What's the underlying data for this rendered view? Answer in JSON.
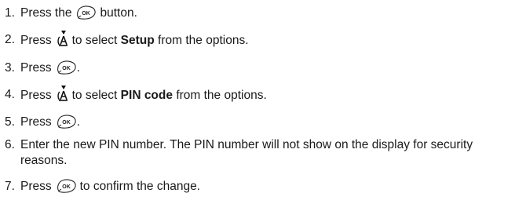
{
  "steps": [
    {
      "num": "1.",
      "before": "Press the",
      "after": "button."
    },
    {
      "num": "2.",
      "before": "Press",
      "mid": "to select",
      "bold": "Setup",
      "after": "from the options."
    },
    {
      "num": "3.",
      "before": "Press",
      "after": "."
    },
    {
      "num": "4.",
      "before": "Press",
      "mid": "to select",
      "bold": "PIN code",
      "after": "from the options."
    },
    {
      "num": "5.",
      "before": "Press",
      "after": "."
    },
    {
      "num": "6.",
      "text": "Enter the new PIN number. The PIN number will not show on the display for security reasons."
    },
    {
      "num": "7.",
      "before": "Press",
      "after": "to confirm the change."
    }
  ],
  "icons": {
    "ok_button": {
      "name": "ok-button-icon",
      "label": "OK"
    },
    "nav_key": {
      "name": "navigation-key-icon"
    }
  }
}
